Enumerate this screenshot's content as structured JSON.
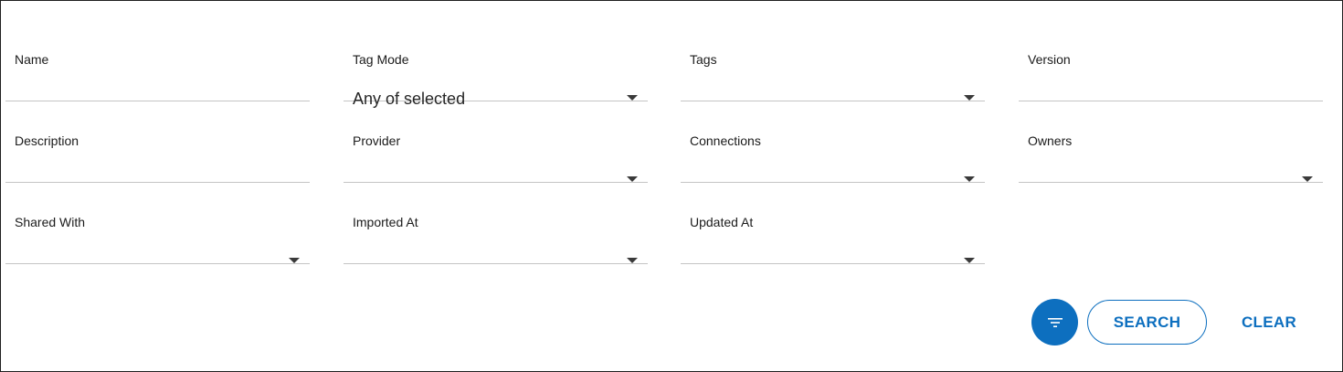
{
  "filters": {
    "name": {
      "label": "Name",
      "value": ""
    },
    "tag_mode": {
      "label": "Tag Mode",
      "value": "Any of selected"
    },
    "tags": {
      "label": "Tags",
      "value": ""
    },
    "version": {
      "label": "Version",
      "value": ""
    },
    "description": {
      "label": "Description",
      "value": ""
    },
    "provider": {
      "label": "Provider",
      "value": ""
    },
    "connections": {
      "label": "Connections",
      "value": ""
    },
    "owners": {
      "label": "Owners",
      "value": ""
    },
    "shared_with": {
      "label": "Shared With",
      "value": ""
    },
    "imported_at": {
      "label": "Imported At",
      "value": ""
    },
    "updated_at": {
      "label": "Updated At",
      "value": ""
    }
  },
  "actions": {
    "filter_icon": "filter-icon",
    "search_label": "SEARCH",
    "clear_label": "CLEAR"
  },
  "colors": {
    "accent": "#0d6fbf",
    "underline": "#c4c4c4",
    "border": "#1f1f1f"
  }
}
